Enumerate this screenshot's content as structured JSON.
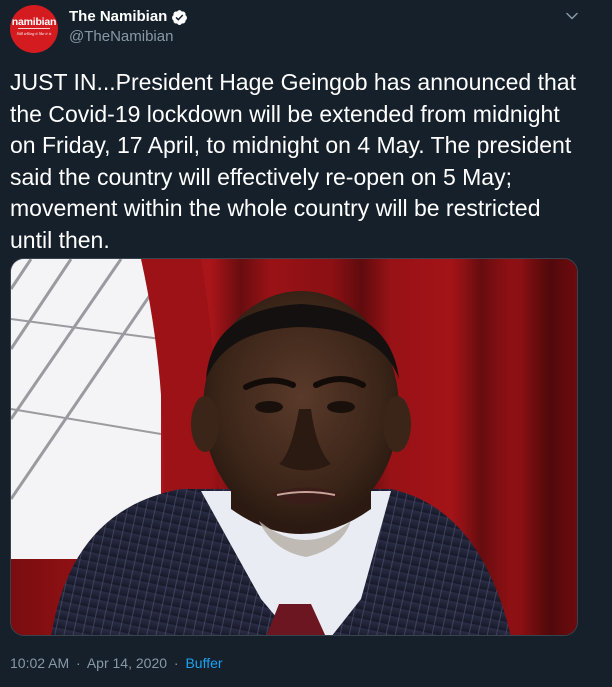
{
  "tweet": {
    "display_name": "The Namibian",
    "handle": "@TheNamibian",
    "verified": true,
    "avatar": {
      "logo_text": "namibian",
      "tagline": "Still telling it like it is"
    },
    "text": "JUST IN...President Hage Geingob has announced that\nthe Covid-19 lockdown will be extended from midnight\non Friday, 17 April, to midnight on 4 May. The president\nsaid the country will effectively re-open on 5 May;\nmovement within the whole country will be restricted\nuntil then.",
    "media": {
      "alt": "President Hage Geingob speaking in front of a red curtain"
    },
    "time": "10:02 AM",
    "date": "Apr 14, 2020",
    "separator": "·",
    "source": "Buffer"
  },
  "colors": {
    "background": "#15202b",
    "primary_text": "#ffffff",
    "secondary_text": "#8899a6",
    "accent": "#1da1f2",
    "avatar_red": "#d31b20"
  },
  "icons": {
    "verified": "verified-badge-icon",
    "caret": "chevron-down-icon"
  }
}
